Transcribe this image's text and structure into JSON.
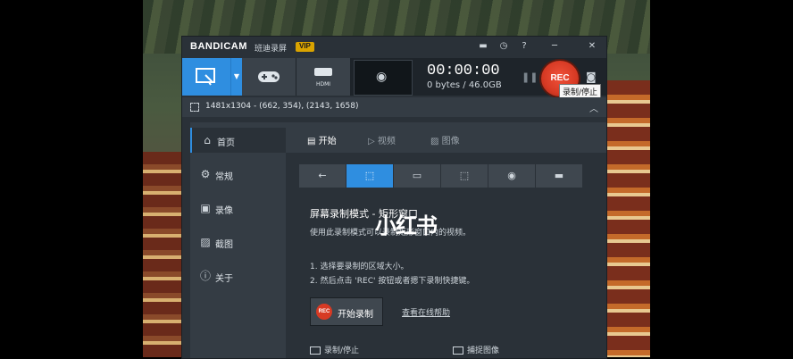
{
  "titlebar": {
    "logo": "BANDICAM",
    "subtitle": "班迪录屏",
    "vip": "VIP"
  },
  "toolbar": {
    "timer": "00:00:00",
    "size": "0 bytes / 46.0GB",
    "rec_label": "REC",
    "tooltip": "录制/停止",
    "hdmi_label": "HDMI"
  },
  "infobar": {
    "region": "1481x1304 - (662, 354), (2143, 1658)"
  },
  "sidebar": {
    "items": [
      {
        "label": "首页",
        "icon": "home-icon"
      },
      {
        "label": "常规",
        "icon": "gear-icon"
      },
      {
        "label": "录像",
        "icon": "video-icon"
      },
      {
        "label": "截图",
        "icon": "image-icon"
      },
      {
        "label": "关于",
        "icon": "info-icon"
      }
    ]
  },
  "tabs": [
    {
      "label": "开始"
    },
    {
      "label": "视频"
    },
    {
      "label": "图像"
    }
  ],
  "main": {
    "heading": "屏幕录制模式 - 矩形窗口",
    "description": "使用此录制模式可以录制矩形窗口内的视频。",
    "steps": [
      "1. 选择要录制的区域大小。",
      "2. 然后点击 'REC' 按钮或者摁下录制快捷键。"
    ],
    "start_button": "开始录制",
    "start_button_dot": "REC",
    "help_link": "查看在线帮助",
    "bottom_items": [
      "录制/停止",
      "捕捉图像"
    ]
  },
  "watermark": "小红书"
}
